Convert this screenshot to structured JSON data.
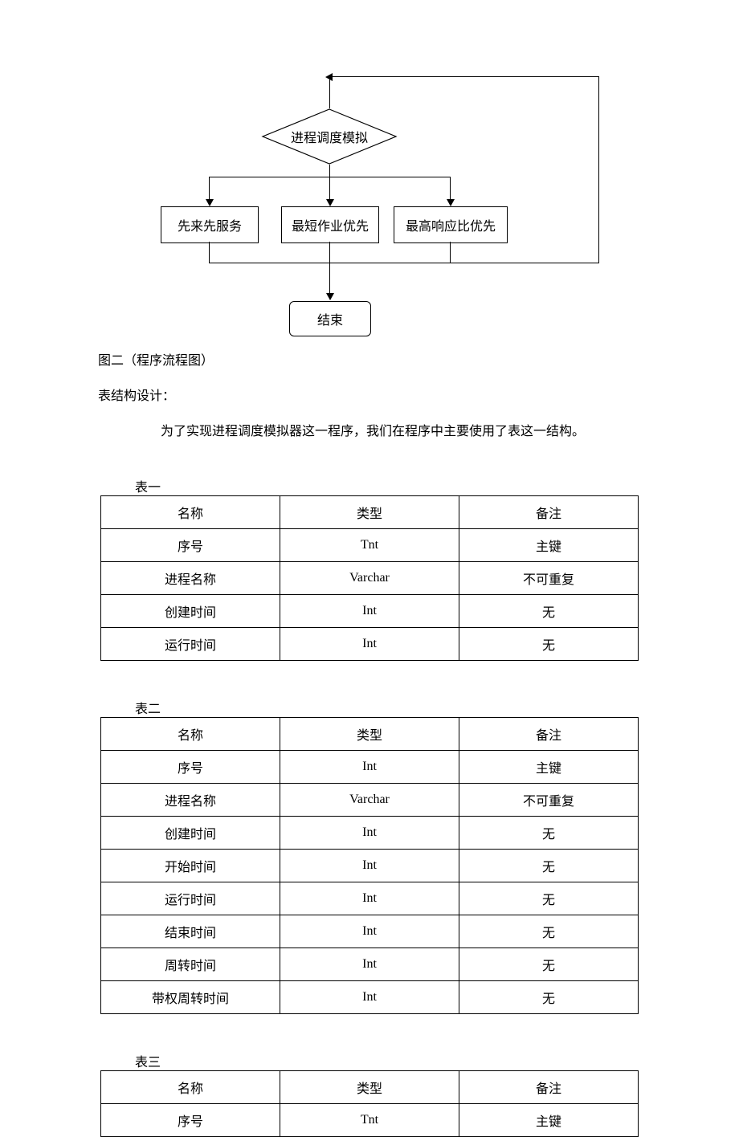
{
  "diagram": {
    "decision": "进程调度模拟",
    "branches": [
      "先来先服务",
      "最短作业优先",
      "最高响应比优先"
    ],
    "end": "结束"
  },
  "caption": "图二（程序流程图）",
  "heading": "表结构设计：",
  "para": "为了实现进程调度模拟器这一程序，我们在程序中主要使用了表这一结构。",
  "tables": [
    {
      "label": "表一",
      "rows": [
        [
          "名称",
          "类型",
          "备注"
        ],
        [
          "序号",
          "Tnt",
          "主键"
        ],
        [
          "进程名称",
          "Varchar",
          "不可重复"
        ],
        [
          "创建时间",
          "Int",
          "无"
        ],
        [
          "运行时间",
          "Int",
          "无"
        ]
      ]
    },
    {
      "label": "表二",
      "rows": [
        [
          "名称",
          "类型",
          "备注"
        ],
        [
          "序号",
          "Int",
          "主键"
        ],
        [
          "进程名称",
          "Varchar",
          "不可重复"
        ],
        [
          "创建时间",
          "Int",
          "无"
        ],
        [
          "开始时间",
          "Int",
          "无"
        ],
        [
          "运行时间",
          "Int",
          "无"
        ],
        [
          "结束时间",
          "Int",
          "无"
        ],
        [
          "周转时间",
          "Int",
          "无"
        ],
        [
          "带权周转时间",
          "Int",
          "无"
        ]
      ]
    },
    {
      "label": "表三",
      "rows": [
        [
          "名称",
          "类型",
          "备注"
        ],
        [
          "序号",
          "Tnt",
          "主键"
        ]
      ]
    }
  ]
}
